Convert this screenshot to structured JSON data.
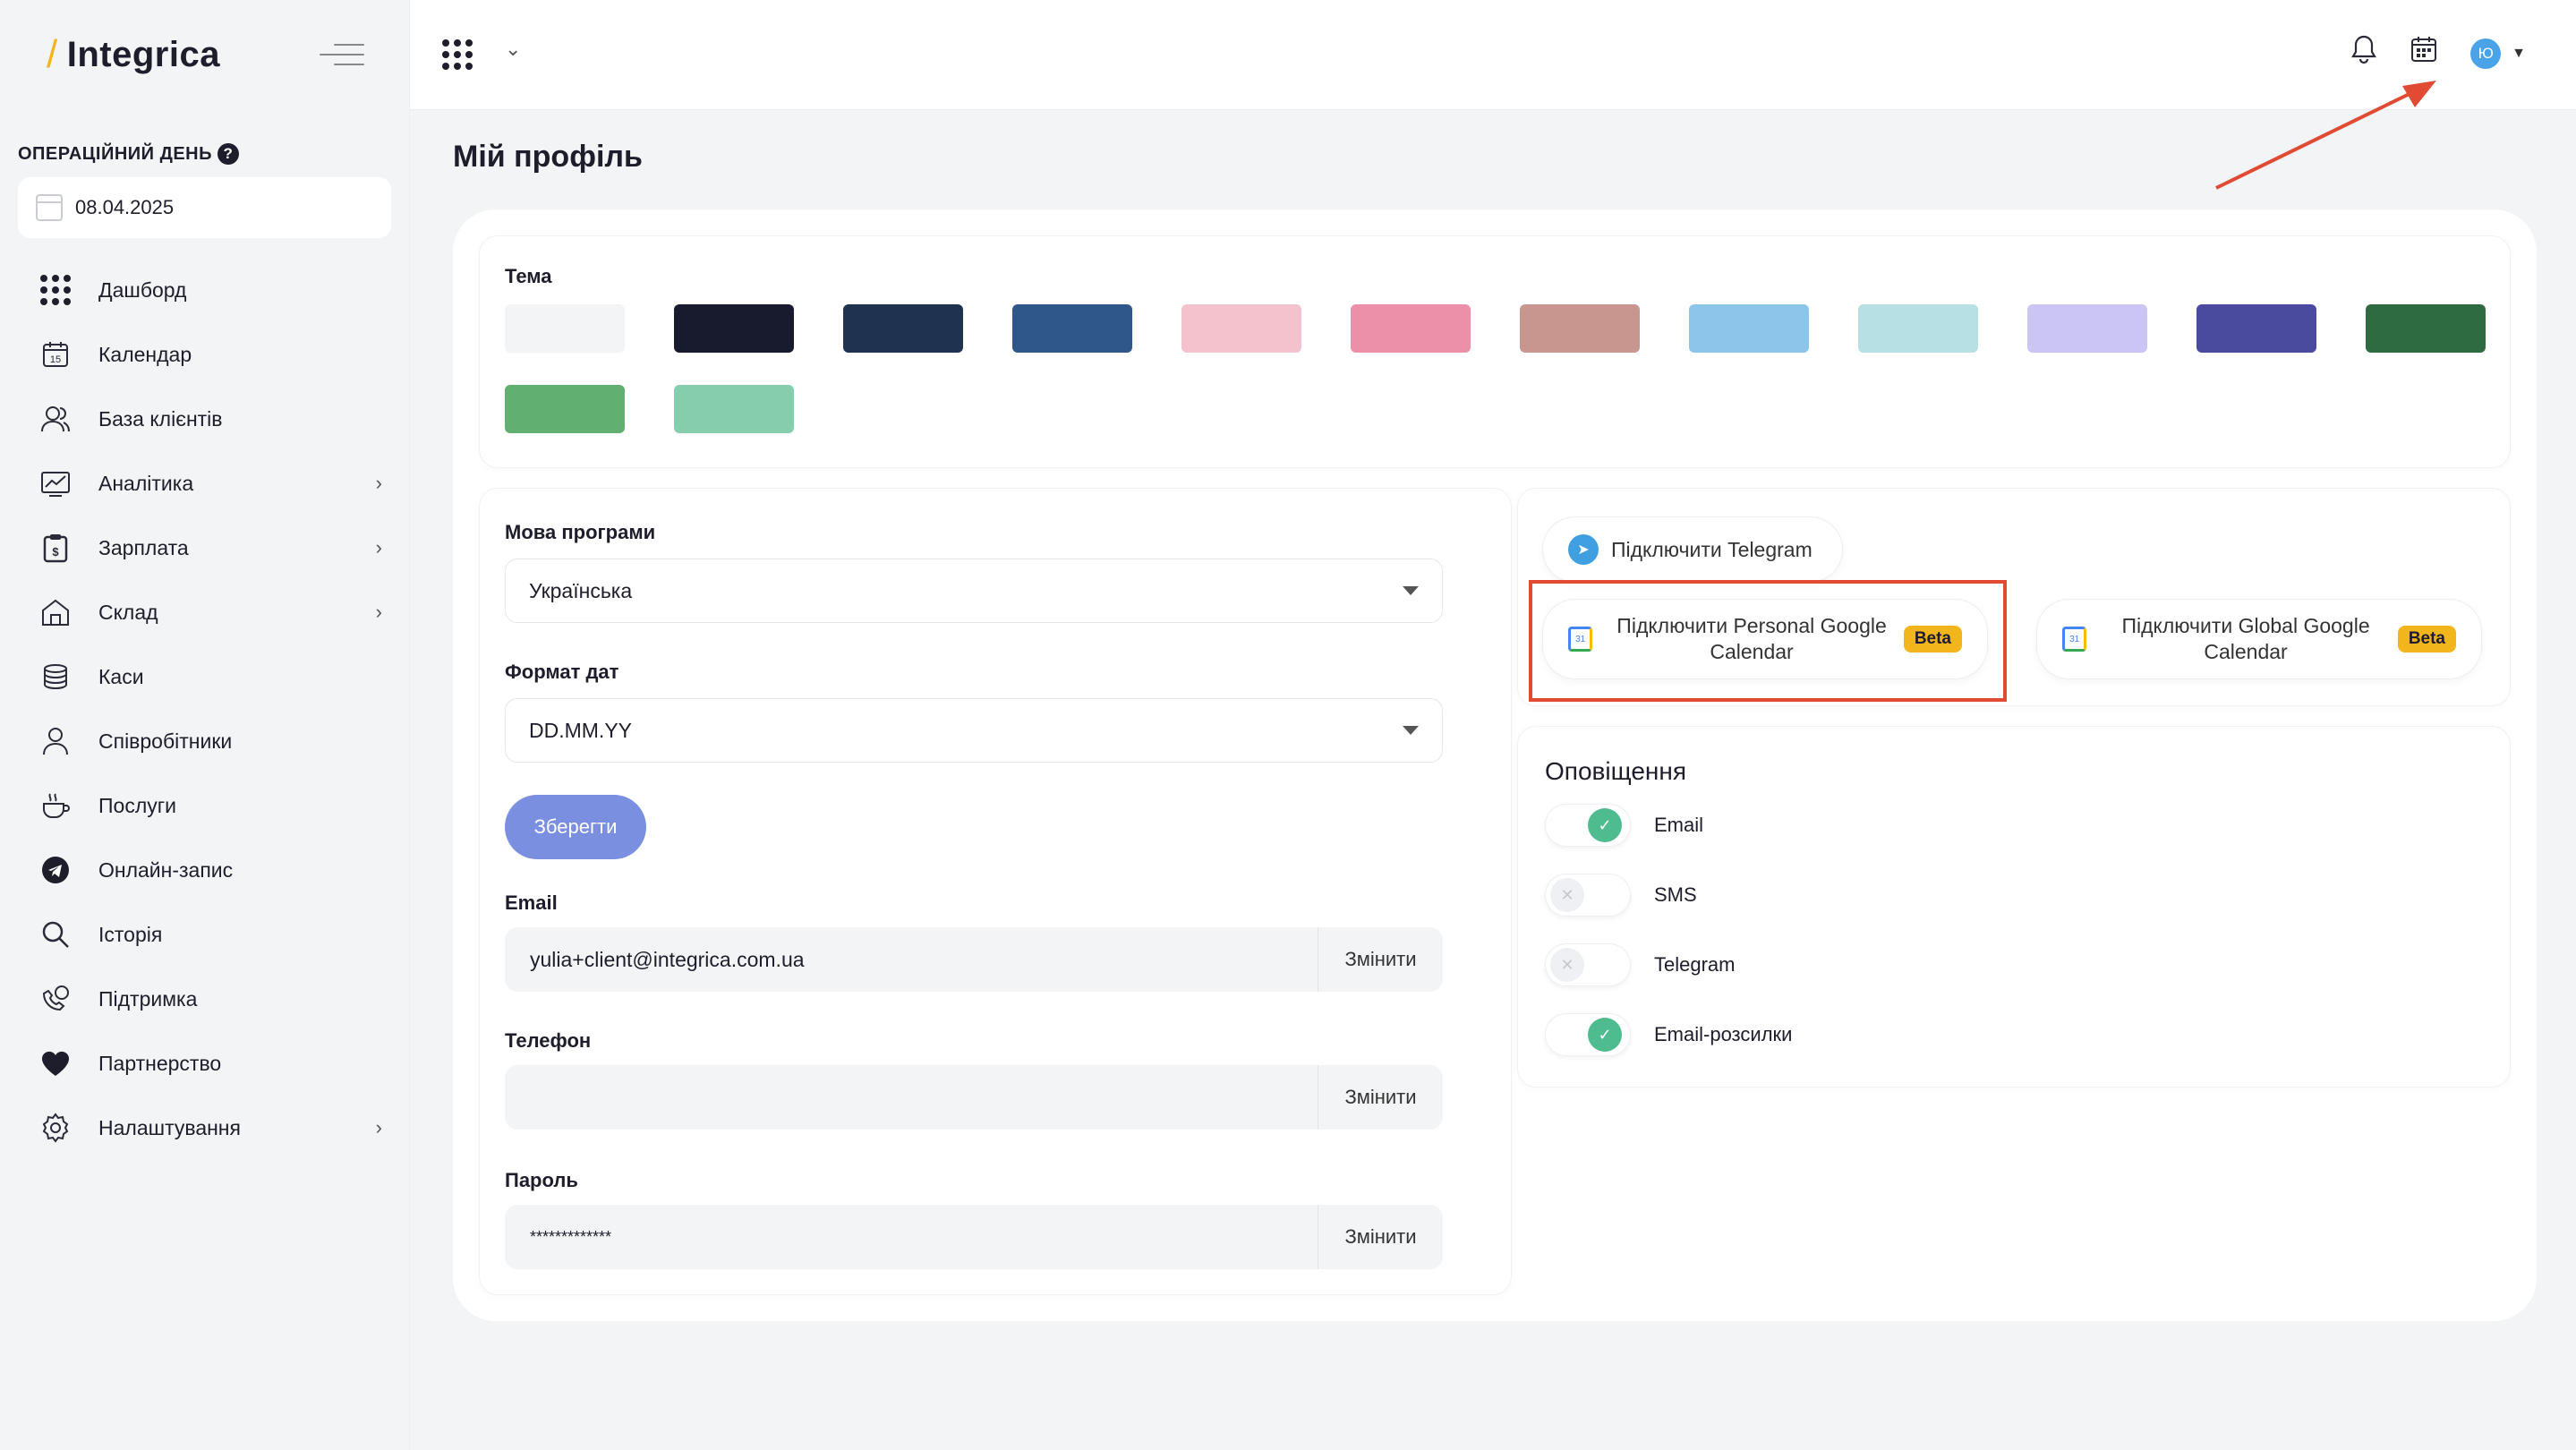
{
  "brand": {
    "name": "Integrica",
    "slash": "/"
  },
  "op_day": {
    "label": "ОПЕРАЦІЙНИЙ ДЕНЬ",
    "help": "?",
    "date": "08.04.2025"
  },
  "nav": [
    {
      "label": "Дашборд",
      "icon": "grid-icon",
      "chevron": false
    },
    {
      "label": "Календар",
      "icon": "calendar-icon",
      "chevron": false
    },
    {
      "label": "База клієнтів",
      "icon": "clients-icon",
      "chevron": false
    },
    {
      "label": "Аналітика",
      "icon": "analytics-icon",
      "chevron": true
    },
    {
      "label": "Зарплата",
      "icon": "salary-icon",
      "chevron": true
    },
    {
      "label": "Склад",
      "icon": "warehouse-icon",
      "chevron": true
    },
    {
      "label": "Каси",
      "icon": "cash-icon",
      "chevron": false
    },
    {
      "label": "Співробітники",
      "icon": "staff-icon",
      "chevron": false
    },
    {
      "label": "Послуги",
      "icon": "services-icon",
      "chevron": false
    },
    {
      "label": "Онлайн-запис",
      "icon": "online-booking-icon",
      "chevron": false
    },
    {
      "label": "Історія",
      "icon": "history-icon",
      "chevron": false
    },
    {
      "label": "Підтримка",
      "icon": "support-icon",
      "chevron": false
    },
    {
      "label": "Партнерство",
      "icon": "heart-icon",
      "chevron": false
    },
    {
      "label": "Налаштування",
      "icon": "settings-icon",
      "chevron": true
    }
  ],
  "header": {
    "avatar_initial": "Ю"
  },
  "page": {
    "title": "Мій профіль"
  },
  "theme": {
    "label": "Тема",
    "colors": [
      "#f3f4f6",
      "#181a2e",
      "#1f3350",
      "#2f5789",
      "#f4c2cc",
      "#ec8fa8",
      "#c9968f",
      "#8cc5ea",
      "#b7e0e4",
      "#cbc5f4",
      "#4a4a9e",
      "#2f6b41",
      "#61b072",
      "#86cdad"
    ]
  },
  "settings": {
    "language_label": "Мова програми",
    "language_value": "Українська",
    "date_format_label": "Формат дат",
    "date_format_value": "DD.MM.YY",
    "save_label": "Зберегти",
    "email_label": "Email",
    "email_value": "yulia+client@integrica.com.ua",
    "phone_label": "Телефон",
    "phone_value": "",
    "password_label": "Пароль",
    "password_value": "*************",
    "change_label": "Змінити"
  },
  "integrations": {
    "telegram": "Підключити Telegram",
    "personal_google": "Підключити Personal Google Calendar",
    "global_google": "Підключити Global Google Calendar",
    "beta": "Beta"
  },
  "notifications": {
    "title": "Оповіщення",
    "items": [
      {
        "label": "Email",
        "on": true
      },
      {
        "label": "SMS",
        "on": false
      },
      {
        "label": "Telegram",
        "on": false
      },
      {
        "label": "Email-розсилки",
        "on": true
      }
    ]
  },
  "colors": {
    "accent": "#7b8fe0",
    "toggle_on": "#4fbc90",
    "beta": "#f3b51c",
    "annotation": "#e24b33"
  }
}
